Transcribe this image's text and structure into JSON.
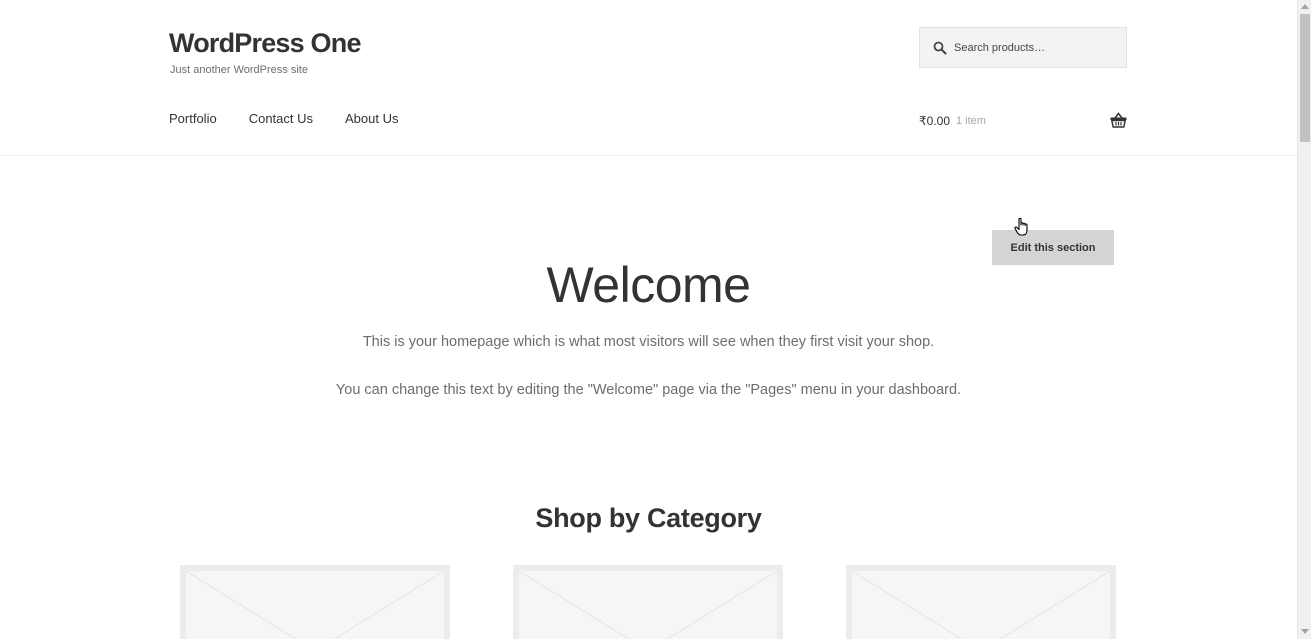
{
  "site": {
    "title": "WordPress One",
    "tagline": "Just another WordPress site"
  },
  "search": {
    "placeholder": "Search products…",
    "icon": "search-icon"
  },
  "nav": {
    "items": [
      {
        "label": "Portfolio"
      },
      {
        "label": "Contact Us"
      },
      {
        "label": "About Us"
      }
    ]
  },
  "cart": {
    "amount": "₹0.00",
    "count": "1 item",
    "icon": "basket-icon"
  },
  "edit_section": {
    "label": "Edit this section"
  },
  "welcome": {
    "title": "Welcome",
    "paragraph1": "This is your homepage which is what most visitors will see when they first visit your shop.",
    "paragraph2": "You can change this text by editing the \"Welcome\" page via the \"Pages\" menu in your dashboard."
  },
  "shop": {
    "section_title": "Shop by Category",
    "category_count": 3
  },
  "colors": {
    "text_dark": "#333333",
    "text_muted": "#6d6d6d",
    "button_bg": "#d4d4d4",
    "search_bg": "#f3f3f2"
  }
}
